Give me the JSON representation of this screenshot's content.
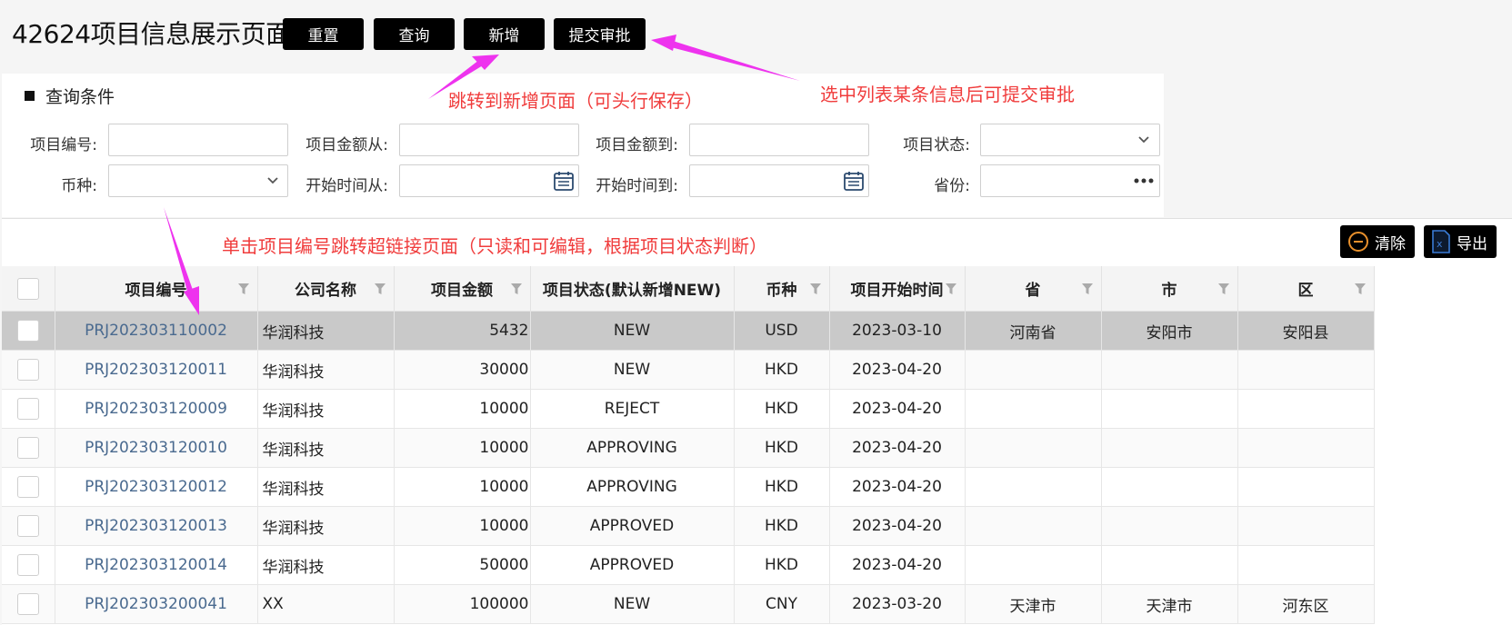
{
  "header": {
    "title": "42624项目信息展示页面",
    "buttons": {
      "reset": "重置",
      "query": "查询",
      "add": "新增",
      "submit": "提交审批"
    }
  },
  "query_panel": {
    "title": "查询条件",
    "fields": {
      "project_no": {
        "label": "项目编号:",
        "value": ""
      },
      "amount_from": {
        "label": "项目金额从:",
        "value": ""
      },
      "amount_to": {
        "label": "项目金额到:",
        "value": ""
      },
      "status": {
        "label": "项目状态:",
        "value": ""
      },
      "currency": {
        "label": "币种:",
        "value": ""
      },
      "start_from": {
        "label": "开始时间从:",
        "value": ""
      },
      "start_to": {
        "label": "开始时间到:",
        "value": ""
      },
      "province": {
        "label": "省份:",
        "value": ""
      }
    }
  },
  "grid": {
    "toolbar": {
      "clear": "清除",
      "export": "导出"
    },
    "columns": [
      "项目编号",
      "公司名称",
      "项目金额",
      "项目状态(默认新增NEW)",
      "币种",
      "项目开始时间",
      "省",
      "市",
      "区"
    ],
    "rows": [
      [
        "PRJ202303110002",
        "华润科技",
        "5432",
        "NEW",
        "USD",
        "2023-03-10",
        "河南省",
        "安阳市",
        "安阳县"
      ],
      [
        "PRJ202303120011",
        "华润科技",
        "30000",
        "NEW",
        "HKD",
        "2023-04-20",
        "",
        "",
        ""
      ],
      [
        "PRJ202303120009",
        "华润科技",
        "10000",
        "REJECT",
        "HKD",
        "2023-04-20",
        "",
        "",
        ""
      ],
      [
        "PRJ202303120010",
        "华润科技",
        "10000",
        "APPROVING",
        "HKD",
        "2023-04-20",
        "",
        "",
        ""
      ],
      [
        "PRJ202303120012",
        "华润科技",
        "10000",
        "APPROVING",
        "HKD",
        "2023-04-20",
        "",
        "",
        ""
      ],
      [
        "PRJ202303120013",
        "华润科技",
        "10000",
        "APPROVED",
        "HKD",
        "2023-04-20",
        "",
        "",
        ""
      ],
      [
        "PRJ202303120014",
        "华润科技",
        "50000",
        "APPROVED",
        "HKD",
        "2023-04-20",
        "",
        "",
        ""
      ],
      [
        "PRJ202303200041",
        "XX",
        "100000",
        "NEW",
        "CNY",
        "2023-03-20",
        "天津市",
        "天津市",
        "河东区"
      ]
    ],
    "selected_row": 0
  },
  "annotations": {
    "add_note": "跳转到新增页面（可头行保存）",
    "submit_note": "选中列表某条信息后可提交审批",
    "link_note": "单击项目编号跳转超链接页面（只读和可编辑，根据项目状态判断）"
  },
  "colors": {
    "annotation": "#f03c3c",
    "arrow": "#ee33ee",
    "link": "#4a6a8f",
    "button": "#000000"
  },
  "icons": [
    "chevron-down-icon",
    "calendar-icon",
    "more-icon",
    "filter-icon",
    "minus-circle-icon",
    "excel-icon"
  ]
}
